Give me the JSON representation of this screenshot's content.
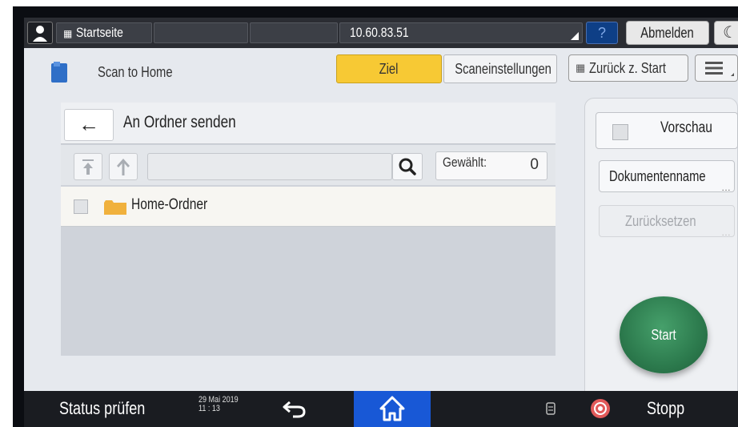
{
  "topbar": {
    "home_tab": "Startseite",
    "ip_address": "10.60.83.51",
    "help": "?",
    "logout": "Abmelden"
  },
  "app": {
    "title": "Scan to Home",
    "tabs": [
      {
        "label": "Ziel",
        "active": true
      },
      {
        "label": "Scaneinstellungen",
        "active": false
      }
    ],
    "back_to_start": "Zurück z. Start"
  },
  "panel": {
    "title": "An Ordner senden",
    "path_value": "",
    "selected_label": "Gewählt:",
    "selected_count": "0",
    "items": [
      {
        "label": "Home-Ordner",
        "checked": false
      }
    ]
  },
  "right": {
    "preview": "Vorschau",
    "document_name": "Dokumentenname",
    "reset": "Zurücksetzen",
    "start": "Start"
  },
  "bottombar": {
    "status": "Status prüfen",
    "date": "29 Mai 2019",
    "time": "11 : 13",
    "stop": "Stopp"
  },
  "colors": {
    "active_tab": "#f7c934",
    "start_button": "#2c7a4d",
    "home_button": "#1858d6",
    "stop_icon": "#e25a5a"
  }
}
